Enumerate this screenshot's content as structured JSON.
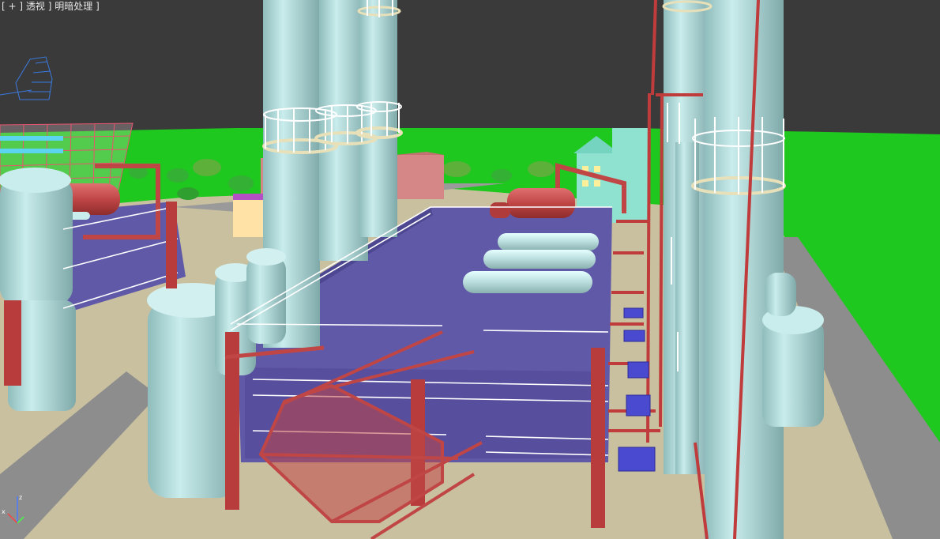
{
  "viewport_label": {
    "open": "[",
    "plus": "+",
    "sep1": "]",
    "view_mode": "透视",
    "sep2": "]",
    "shading_mode": "明暗处理",
    "close": "]"
  },
  "axis_gizmo": {
    "z": "z",
    "x": "x"
  },
  "colors": {
    "viewport_bg": "#3a3a3a",
    "grass": "#1ec81e",
    "ground": "#c9c0a0",
    "road": "#8d8d8d",
    "platform": "#6059a8",
    "tank": "#b7dede",
    "pipe_red": "#b83c3c",
    "railing": "#ffffff",
    "wireframe_building": "#e8556e",
    "pump": "#4a4ad0"
  }
}
